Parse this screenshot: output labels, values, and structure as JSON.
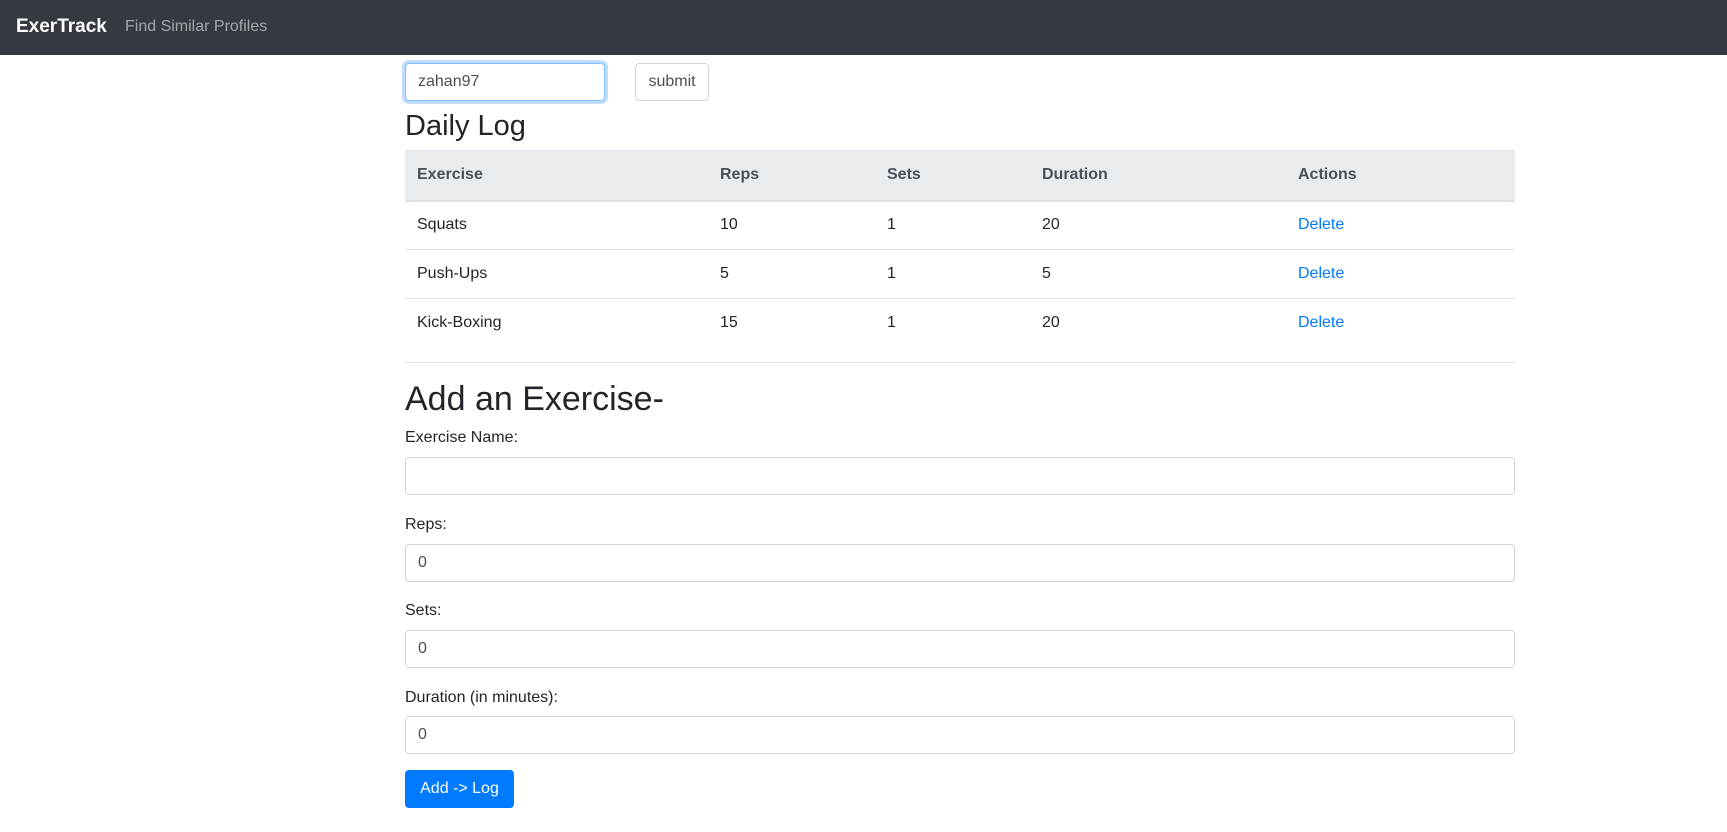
{
  "navbar": {
    "brand": "ExerTrack",
    "link": "Find Similar Profiles"
  },
  "user_form": {
    "username_value": "zahan97",
    "submit_label": "submit"
  },
  "daily_log": {
    "heading": "Daily Log",
    "columns": [
      "Exercise",
      "Reps",
      "Sets",
      "Duration",
      "Actions"
    ],
    "rows": [
      {
        "exercise": "Squats",
        "reps": "10",
        "sets": "1",
        "duration": "20",
        "action": "Delete"
      },
      {
        "exercise": "Push-Ups",
        "reps": "5",
        "sets": "1",
        "duration": "5",
        "action": "Delete"
      },
      {
        "exercise": "Kick-Boxing",
        "reps": "15",
        "sets": "1",
        "duration": "20",
        "action": "Delete"
      }
    ]
  },
  "add_form": {
    "heading": "Add an Exercise-",
    "name_label": "Exercise Name:",
    "name_value": "",
    "reps_label": "Reps:",
    "reps_value": "0",
    "sets_label": "Sets:",
    "sets_value": "0",
    "duration_label": "Duration (in minutes):",
    "duration_value": "0",
    "submit_label": "Add -> Log"
  },
  "colors": {
    "navbar_bg": "#343a40",
    "primary": "#007bff",
    "table_header_bg": "#e9ecef"
  }
}
